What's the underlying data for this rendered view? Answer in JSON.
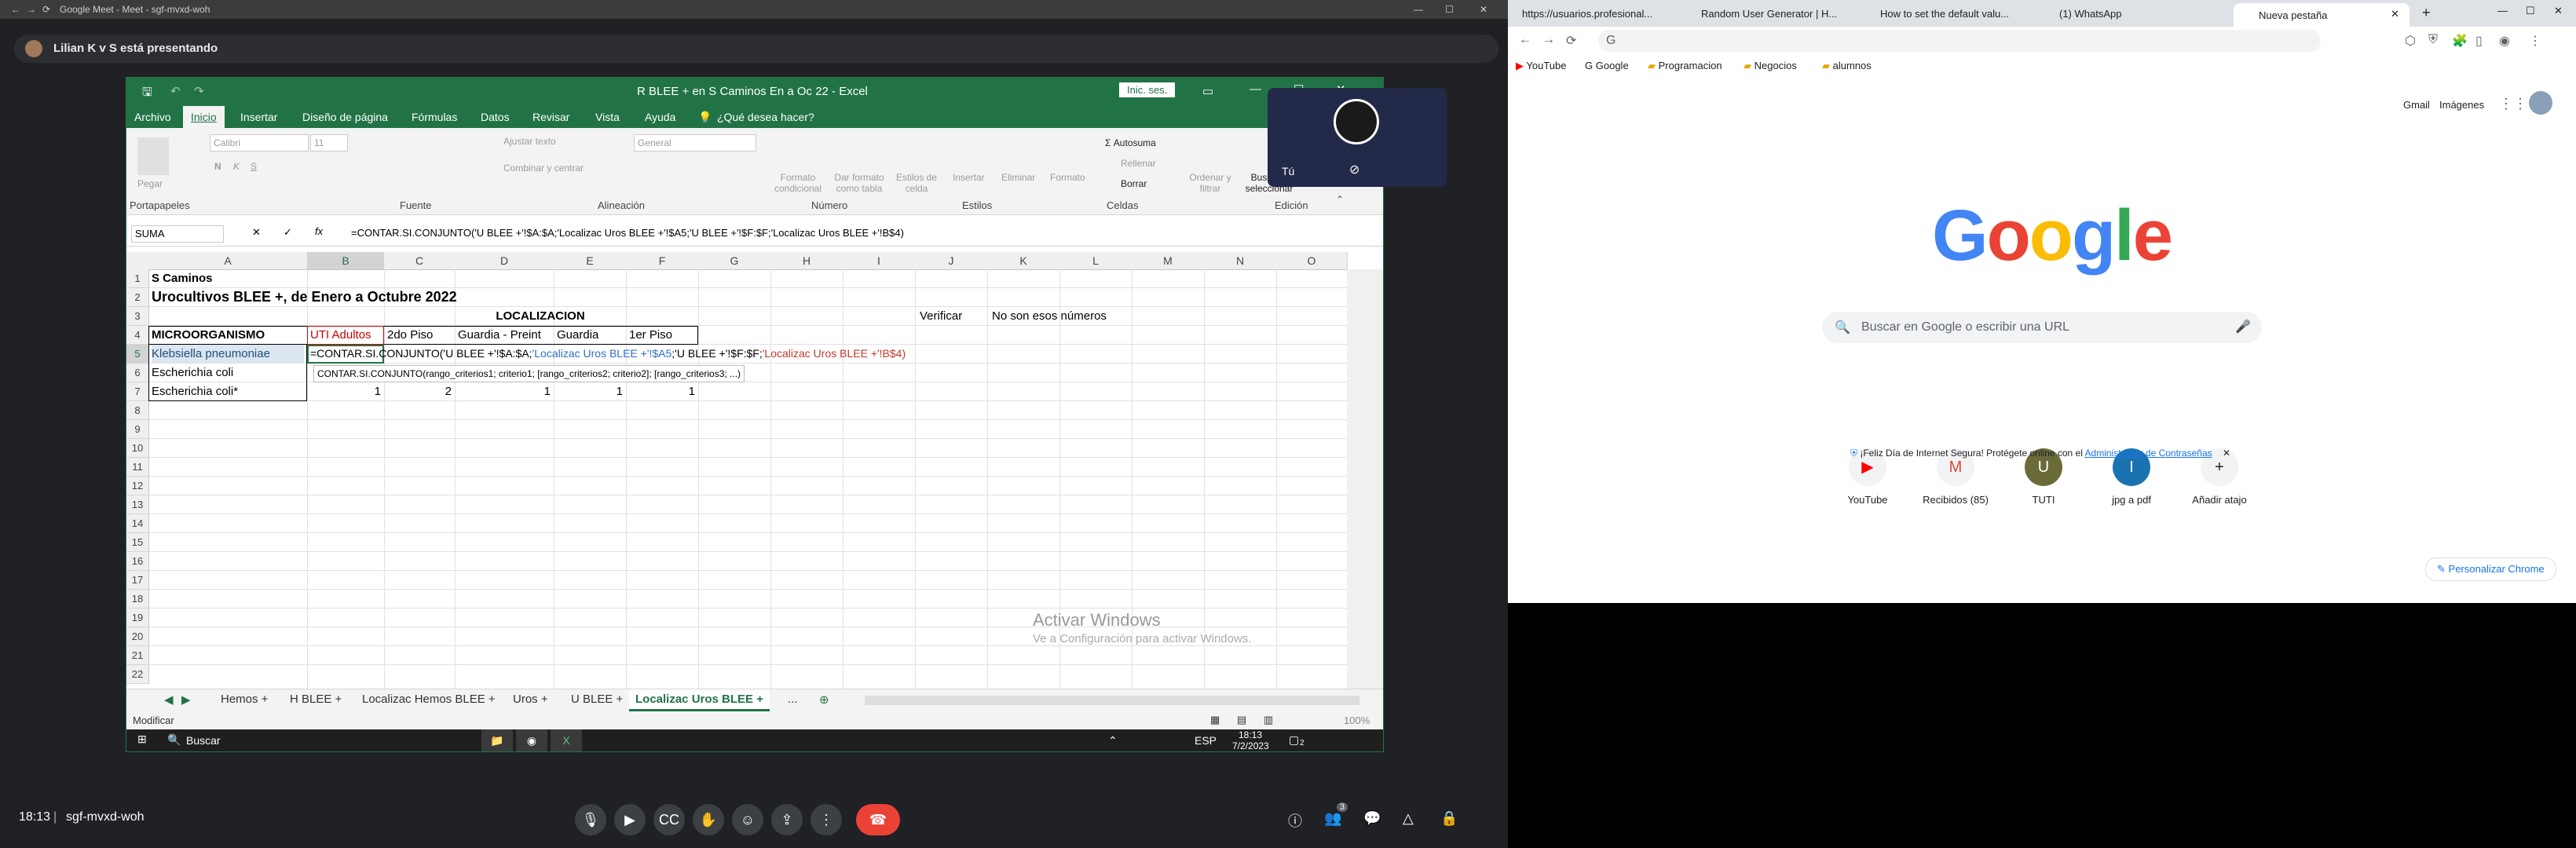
{
  "meet": {
    "title": "Google Meet - Meet - sgf-mvxd-woh",
    "presenting": "Lilian K v S está presentando",
    "time": "18:13",
    "code": "sgf-mvxd-woh",
    "participants_badge": "3"
  },
  "excel": {
    "title": "R  BLEE + en S Caminos En a Oc 22  -  Excel",
    "signin": "Inic. ses.",
    "menu": [
      "Archivo",
      "Inicio",
      "Insertar",
      "Diseño de página",
      "Fórmulas",
      "Datos",
      "Revisar",
      "Vista",
      "Ayuda",
      "¿Qué desea hacer?"
    ],
    "ribbon_groups": [
      "Portapapeles",
      "Fuente",
      "Alineación",
      "Número",
      "Estilos",
      "Celdas",
      "Edición"
    ],
    "ribbon": {
      "paste": "Pegar",
      "font": "Calibri",
      "font_size": "11",
      "wrap": "Ajustar texto",
      "merge": "Combinar y centrar",
      "number_format": "General",
      "cond_format": "Formato condicional",
      "format_table": "Dar formato como tabla",
      "cell_styles": "Estilos de celda",
      "insert": "Insertar",
      "delete": "Eliminar",
      "format": "Formato",
      "autosum": "Autosuma",
      "fill": "Rellenar",
      "clear": "Borrar",
      "sort": "Ordenar y filtrar",
      "find": "Buscar y seleccionar"
    },
    "name_box": "SUMA",
    "formula": "=CONTAR.SI.CONJUNTO('U BLEE +'!$A:$A;'Localizac Uros BLEE +'!$A5;'U BLEE +'!$F:$F;'Localizac Uros BLEE +'!B$4)",
    "columns": [
      "A",
      "B",
      "C",
      "D",
      "E",
      "F",
      "G",
      "H",
      "I",
      "J",
      "K",
      "L",
      "M",
      "N",
      "O"
    ],
    "rows": [
      "1",
      "2",
      "3",
      "4",
      "5",
      "6",
      "7",
      "8",
      "9",
      "10",
      "11",
      "12",
      "13",
      "14",
      "15",
      "16",
      "17",
      "18",
      "19",
      "20",
      "21",
      "22"
    ],
    "cells": {
      "a1": "S Caminos",
      "a2": "Urocultivos BLEE +, de Enero a Octubre 2022",
      "loc": "LOCALIZACION",
      "verificar": "Verificar",
      "no_son": "No son esos números",
      "a4": "MICROORGANISMO",
      "b4": "UTI  Adultos",
      "c4": "2do Piso",
      "d4": "Guardia - Preint",
      "e4": "Guardia",
      "f4": "1er Piso",
      "a5": "Klebsiella pneumoniae",
      "a6": "Escherichia coli",
      "a7": "Escherichia coli*",
      "b7": "1",
      "c7": "2",
      "d7": "1",
      "e7": "1",
      "f7": "1",
      "editing_part1": "=CONTAR.SI.CONJUNTO('U BLEE +'!$A:$A;",
      "editing_part2": "'Localizac Uros BLEE +'!$A5",
      "editing_part3": ";'U BLEE +'!$F:$F;",
      "editing_part4": "'Localizac Uros BLEE +'!B$4)",
      "tooltip": "CONTAR.SI.CONJUNTO(rango_criterios1; criterio1; [rango_criterios2; criterio2]; [rango_criterios3; ...)"
    },
    "watermark_1": "Activar Windows",
    "watermark_2": "Ve a Configuración para activar Windows.",
    "sheet_tabs": [
      "Hemos +",
      "H BLEE +",
      "Localizac Hemos BLEE +",
      "Uros +",
      "U BLEE +",
      "Localizac Uros BLEE +"
    ],
    "more_tabs": "...",
    "status_mode": "Modificar",
    "zoom": "100%",
    "taskbar": {
      "search": "Buscar",
      "lang": "ESP",
      "time": "18:13",
      "date": "7/2/2023",
      "notif": "2"
    }
  },
  "obs": {
    "label": "Tú"
  },
  "chrome": {
    "tabs": [
      "https://usuarios.profesional...",
      "Random User Generator | H...",
      "How to set the default valu...",
      "(1) WhatsApp",
      "Nueva pestaña"
    ],
    "bookmarks": [
      "YouTube",
      "Google",
      "Programacion",
      "Negocios",
      "alumnos"
    ],
    "top_links": [
      "Gmail",
      "Imágenes"
    ],
    "search_placeholder": "Buscar en Google o escribir una URL",
    "shortcuts": [
      "YouTube",
      "Recibidos (85)",
      "TUTI",
      "jpg a pdf",
      "Añadir atajo"
    ],
    "shortcut_icons": [
      "▶",
      "M",
      "U",
      "I",
      "+"
    ],
    "promo_text": "¡Feliz Día de Internet Segura! Protégete online con el",
    "promo_link": "Administrador de Contraseñas",
    "customize": "Personalizar Chrome",
    "logo": "Google"
  },
  "colors": {
    "excel_green": "#217346",
    "meet_bg": "#202124",
    "hangup_red": "#ea4335",
    "chrome_blue": "#1a73e8"
  }
}
